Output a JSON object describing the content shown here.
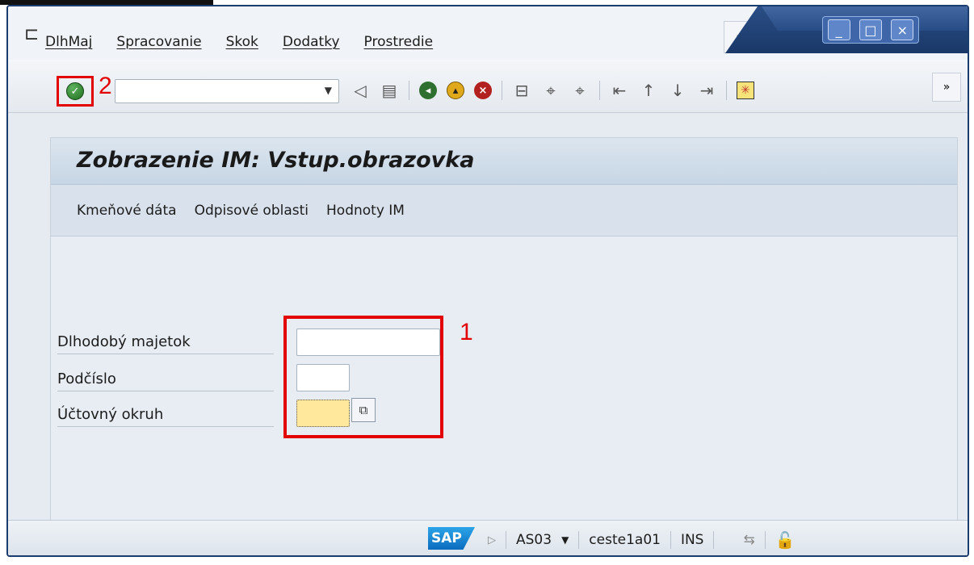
{
  "menu": {
    "items": [
      "DlhMaj",
      "Spracovanie",
      "Skok",
      "Dodatky",
      "Prostredie"
    ],
    "overflow_label": "»"
  },
  "window_controls": {
    "minimize": "_",
    "maximize": "□",
    "close": "×"
  },
  "toolbar": {
    "command_value": "",
    "overflow_label": "»"
  },
  "annotations": {
    "one": "1",
    "two": "2"
  },
  "page": {
    "title": "Zobrazenie IM: Vstup.obrazovka",
    "tabs": [
      "Kmeňové dáta",
      "Odpisové oblasti",
      "Hodnoty IM"
    ]
  },
  "form": {
    "fields": [
      {
        "label": "Dlhodobý majetok",
        "value": ""
      },
      {
        "label": "Podčíslo",
        "value": ""
      },
      {
        "label": "Účtovný okruh",
        "value": ""
      }
    ]
  },
  "status": {
    "logo": "SAP",
    "transaction": "AS03",
    "server": "ceste1a01",
    "mode": "INS"
  },
  "colors": {
    "annotation_red": "#e30000",
    "required_field": "#ffe79c"
  }
}
